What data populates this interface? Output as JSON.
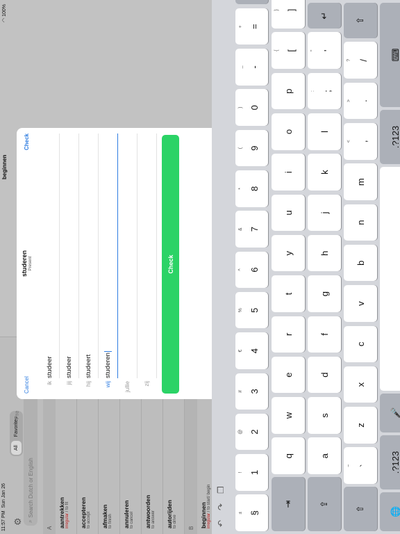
{
  "status": {
    "time": "11:57 PM",
    "date": "Sun Jan 26",
    "battery": "100%"
  },
  "header": {
    "detail_title": "beginnen",
    "side_tab": "Pre"
  },
  "sidebar": {
    "tabs": [
      "All",
      "Favorites"
    ],
    "search_placeholder": "Search Dutch or English",
    "sections": [
      {
        "letter": "A",
        "words": [
          {
            "word": "aantrekken",
            "irregular": "irregular",
            "translation": " / to fit"
          },
          {
            "word": "accepteren",
            "irregular": "",
            "translation": "to accept"
          },
          {
            "word": "afmaken",
            "irregular": "",
            "translation": "to finish"
          },
          {
            "word": "annuleren",
            "irregular": "",
            "translation": "to cancel"
          },
          {
            "word": "antwoorden",
            "irregular": "",
            "translation": "to answer"
          },
          {
            "word": "autorijden",
            "irregular": "",
            "translation": "to drive"
          }
        ]
      },
      {
        "letter": "B",
        "words": [
          {
            "word": "beginnen",
            "irregular": "irregular",
            "translation": " / to start/ begin"
          }
        ]
      }
    ]
  },
  "modal": {
    "cancel": "Cancel",
    "title": "studeren",
    "subtitle": "Present",
    "check_link": "Check",
    "rows": [
      {
        "pronoun": "ik",
        "value": "studeer"
      },
      {
        "pronoun": "jij",
        "value": "studeer"
      },
      {
        "pronoun": "hij",
        "value": "studeert"
      },
      {
        "pronoun": "wij",
        "value": "studeren"
      },
      {
        "pronoun": "jullie",
        "value": ""
      },
      {
        "pronoun": "zij",
        "value": ""
      }
    ],
    "check_button": "Check"
  },
  "keyboard": {
    "row1": [
      [
        "±",
        "§"
      ],
      [
        "!",
        "1"
      ],
      [
        "@",
        "2"
      ],
      [
        "#",
        "3"
      ],
      [
        "€",
        "4"
      ],
      [
        "%",
        "5"
      ],
      [
        "^",
        "6"
      ],
      [
        "&",
        "7"
      ],
      [
        "*",
        "8"
      ],
      [
        "(",
        "9"
      ],
      [
        ")",
        "0"
      ],
      [
        "_",
        "-"
      ],
      [
        "+",
        "="
      ],
      [
        "delete-icon",
        ""
      ]
    ],
    "row2": [
      "q",
      "w",
      "e",
      "r",
      "t",
      "y",
      "u",
      "i",
      "o",
      "p",
      [
        "{",
        "["
      ],
      [
        "}",
        "]"
      ],
      [
        "|",
        "\\"
      ]
    ],
    "row3": [
      "a",
      "s",
      "d",
      "f",
      "g",
      "h",
      "j",
      "k",
      "l",
      [
        ":",
        ";"
      ],
      [
        "\"",
        "'"
      ]
    ],
    "row4": [
      [
        "~",
        "`"
      ],
      "z",
      "x",
      "c",
      "v",
      "b",
      "n",
      "m",
      [
        "<",
        ","
      ],
      [
        ">",
        "."
      ],
      [
        "?",
        "/"
      ]
    ],
    "row5": [
      "globe-icon",
      ".?123",
      "mic-icon",
      "",
      ".?123",
      "keyboard-icon"
    ],
    "tab_label": "⇥",
    "return_label": "↵",
    "shift_label": "⇧",
    "caps_label": "⇪"
  }
}
